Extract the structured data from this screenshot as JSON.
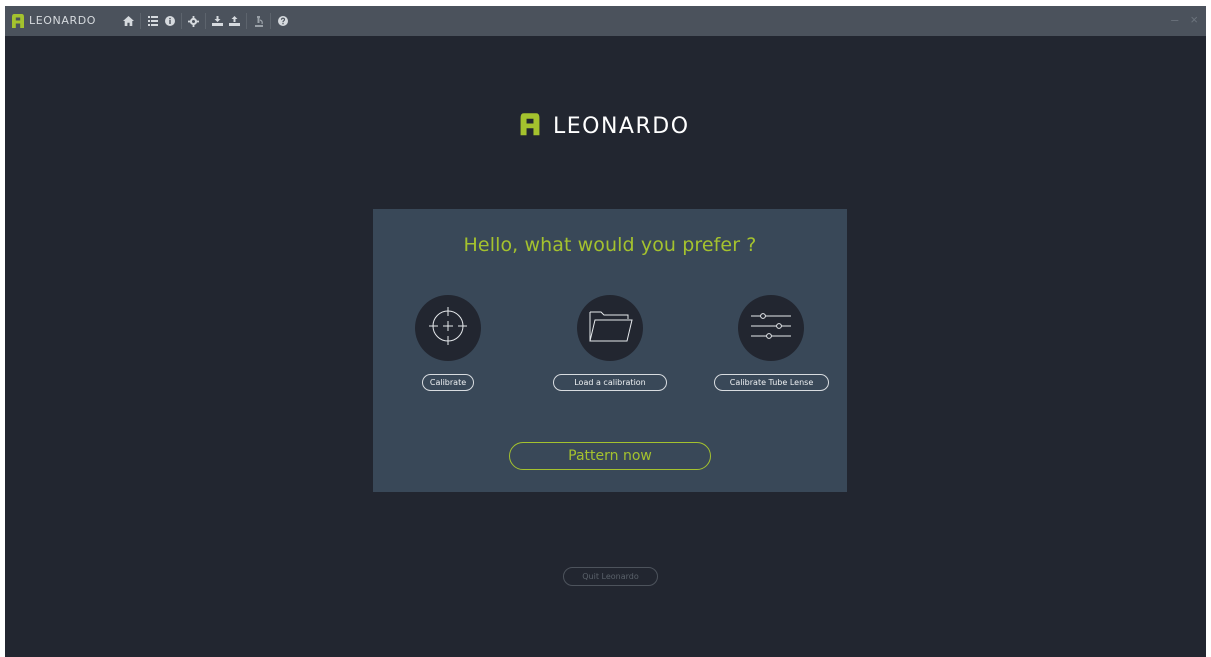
{
  "titlebar": {
    "app_name": "LEONARDO",
    "icons": [
      "home-icon",
      "list-icon",
      "info-icon",
      "gear-icon",
      "download-icon",
      "upload-icon",
      "microscope-icon",
      "help-icon"
    ],
    "minimize": "–",
    "close": "×"
  },
  "brand": {
    "name": "LEONARDO",
    "accent_color": "#a4c22e"
  },
  "panel": {
    "greeting": "Hello, what would you prefer ?",
    "options": [
      {
        "icon": "crosshair-icon",
        "label": "Calibrate"
      },
      {
        "icon": "folder-icon",
        "label": "Load a calibration"
      },
      {
        "icon": "sliders-icon",
        "label": "Calibrate Tube Lense"
      }
    ],
    "primary_action": "Pattern now"
  },
  "footer": {
    "quit_label": "Quit Leonardo"
  },
  "colors": {
    "background": "#222630",
    "titlebar": "#4b525c",
    "panel": "#394858",
    "accent": "#a4c22e"
  }
}
